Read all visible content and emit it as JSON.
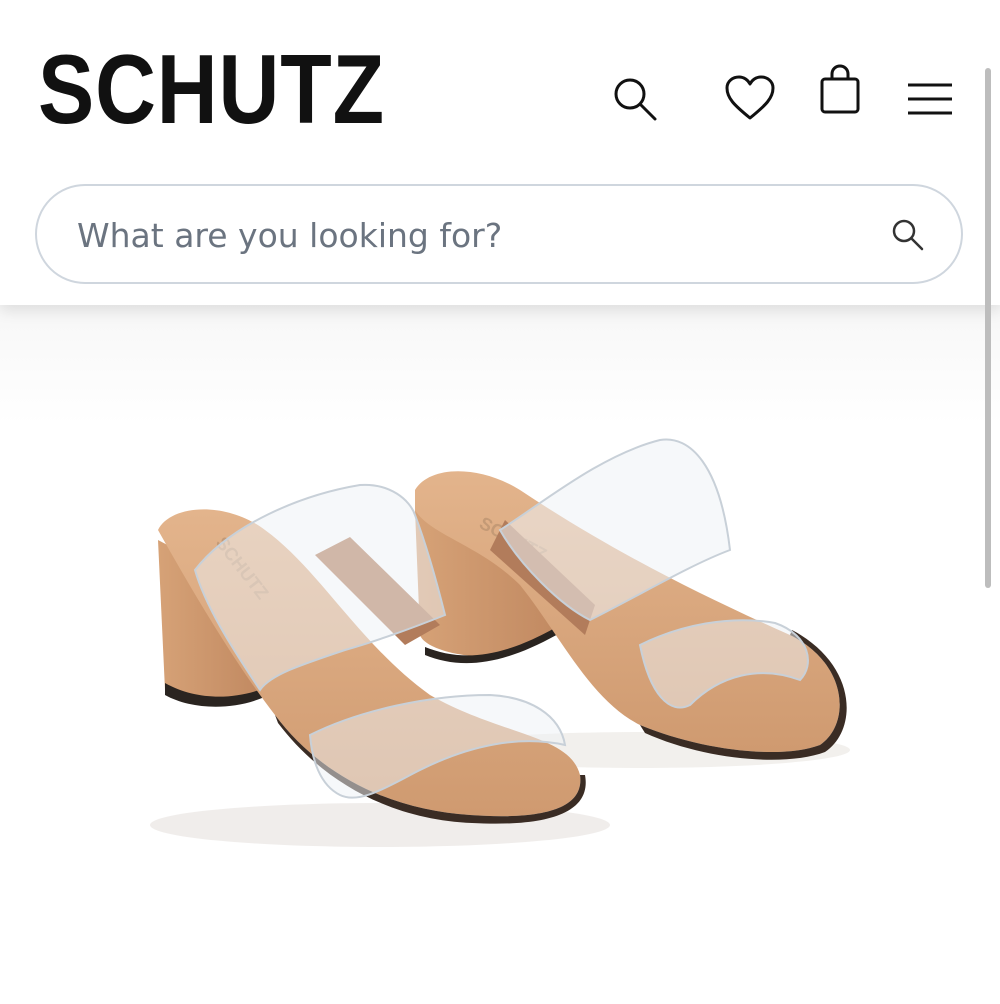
{
  "header": {
    "brand": "SCHUTZ",
    "icons": [
      "search-icon",
      "heart-icon",
      "shopping-bag-icon",
      "menu-icon"
    ]
  },
  "search": {
    "placeholder": "What are you looking for?"
  },
  "product_image": {
    "description_label": "product-image",
    "insole_imprint": "SCHUTZ"
  },
  "colors": {
    "text": "#111111",
    "placeholder": "#6b7480",
    "search_border": "#cfd6de",
    "suede": "#d9a77d",
    "suede_dark": "#c68f65",
    "elastic": "#b27c5b"
  }
}
